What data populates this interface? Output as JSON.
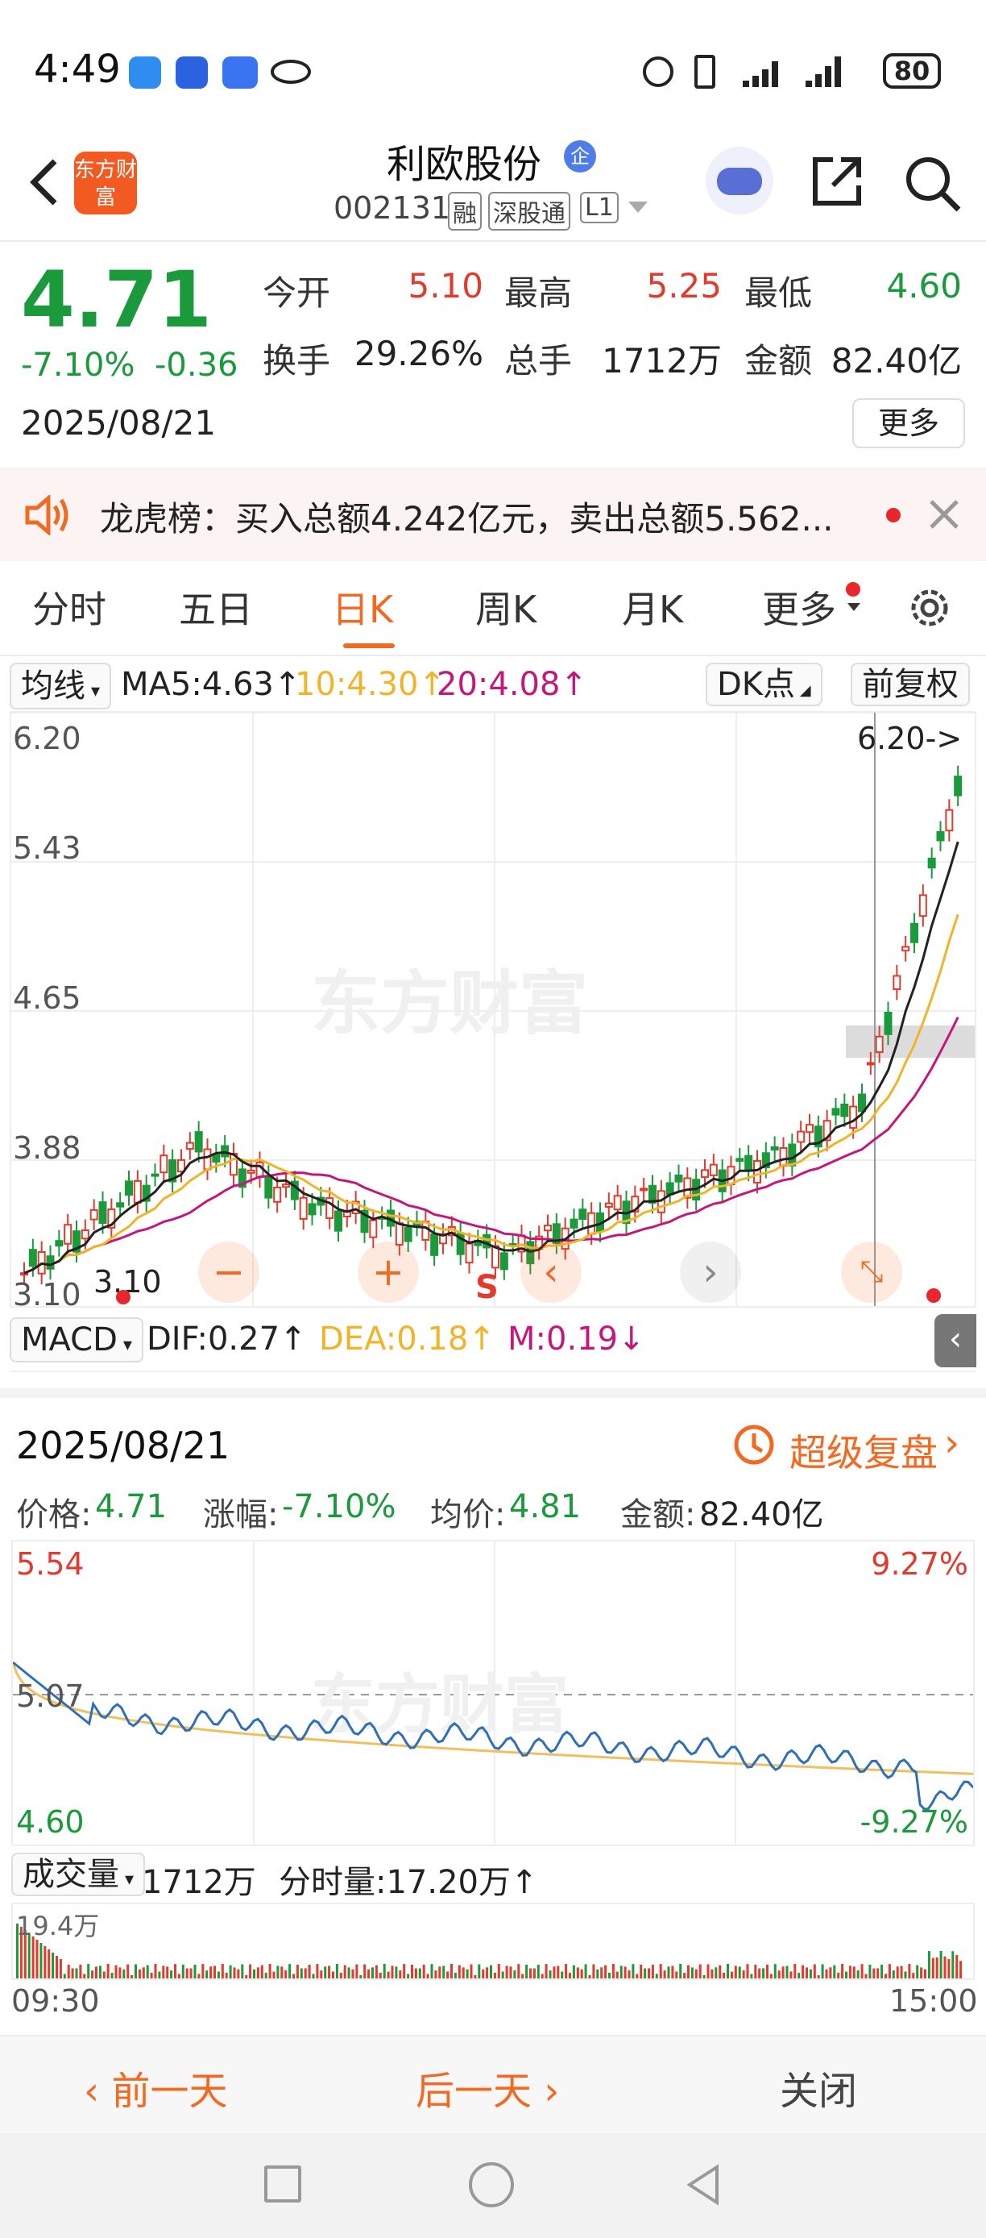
{
  "status_bar": {
    "time": "4:49",
    "battery": "80"
  },
  "header": {
    "title": "利欧股份",
    "code": "002131",
    "tags": [
      "融",
      "深股通",
      "L1"
    ],
    "logo_text": "东方财富"
  },
  "quote": {
    "price": "4.71",
    "change_pct": "-7.10%",
    "change": "-0.36",
    "date": "2025/08/21",
    "open_label": "今开",
    "open": "5.10",
    "high_label": "最高",
    "high": "5.25",
    "low_label": "最低",
    "low": "4.60",
    "turnover_label": "换手",
    "turnover": "29.26%",
    "volume_label": "总手",
    "volume": "1712万",
    "amount_label": "金额",
    "amount": "82.40亿",
    "more_button": "更多"
  },
  "notice": {
    "text": "龙虎榜：买入总额4.242亿元，卖出总额5.562..."
  },
  "tabs": [
    "分时",
    "五日",
    "日K",
    "周K",
    "月K",
    "更多"
  ],
  "active_tab": "日K",
  "kline": {
    "indicator_select": "均线",
    "ma5": "MA5:4.63↑",
    "ma10": "10:4.30↑",
    "ma20": "20:4.08↑",
    "dk_button": "DK点",
    "adjust_button": "前复权",
    "y_labels": [
      "6.20",
      "5.43",
      "4.65",
      "3.88",
      "3.10"
    ],
    "high_marker": "6.20->",
    "low_marker": "3.10",
    "s_marker": "S",
    "watermark": "东方财富",
    "colors": {
      "up": "#e23a2c",
      "down": "#1b9a3c",
      "ma5": "#222222",
      "ma10": "#f0b429",
      "ma20": "#c2187c"
    }
  },
  "macd": {
    "select": "MACD",
    "dif": "DIF:0.27↑",
    "dea": "DEA:0.18↑",
    "m": "M:0.19↓"
  },
  "detail": {
    "date": "2025/08/21",
    "replay_label": "超级复盘",
    "price_label": "价格:",
    "price": "4.71",
    "change_label": "涨幅:",
    "change": "-7.10%",
    "avg_label": "均价:",
    "avg": "4.81",
    "amount_label": "金额:",
    "amount": "82.40亿"
  },
  "intraday": {
    "y_top": "5.54",
    "y_mid": "5.07",
    "y_bottom": "4.60",
    "pct_top": "9.27%",
    "pct_bottom": "-9.27%",
    "volume_select": "成交量",
    "volume_total": "1712万",
    "tick_volume": "分时量:17.20万↑",
    "vol_max": "19.4万",
    "time_start": "09:30",
    "time_end": "15:00"
  },
  "footer": {
    "prev_day": "前一天",
    "next_day": "后一天",
    "close": "关闭"
  }
}
